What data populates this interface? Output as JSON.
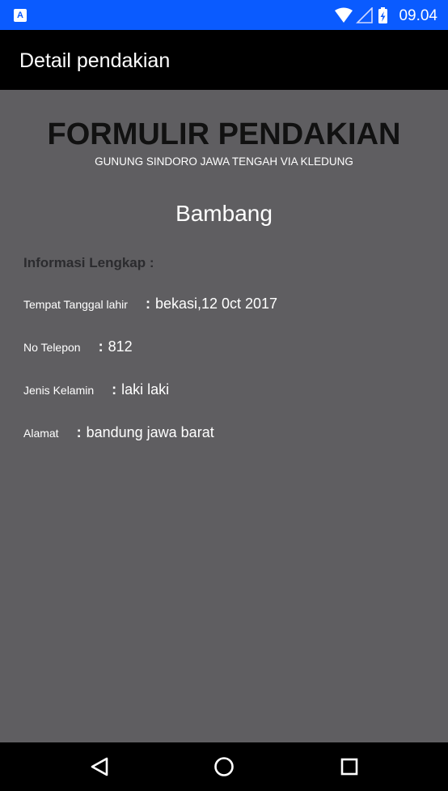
{
  "status_bar": {
    "time": "09.04",
    "notification_icon": "A",
    "icons": [
      "wifi-icon",
      "signal-icon",
      "battery-charging-icon"
    ]
  },
  "app_bar": {
    "title": "Detail pendakian"
  },
  "form": {
    "title": "FORMULIR PENDAKIAN",
    "subtitle": "GUNUNG SINDORO JAWA TENGAH VIA KLEDUNG",
    "name": "Bambang",
    "info_heading": "Informasi Lengkap :",
    "fields": [
      {
        "label": "Tempat Tanggal lahir",
        "separator": ":",
        "value": "bekasi,12 0ct 2017"
      },
      {
        "label": "No Telepon",
        "separator": ":",
        "value": "812"
      },
      {
        "label": "Jenis Kelamin",
        "separator": ":",
        "value": "laki laki"
      },
      {
        "label": "Alamat",
        "separator": ":",
        "value": "bandung jawa barat"
      }
    ]
  },
  "nav_bar": {
    "buttons": [
      "back-icon",
      "home-icon",
      "recents-icon"
    ]
  },
  "colors": {
    "status_bar": "#0a5bff",
    "app_bar": "#000000",
    "content_bg": "#5f5e61",
    "title_text": "#111111",
    "heading_text": "#2b2b2e"
  }
}
